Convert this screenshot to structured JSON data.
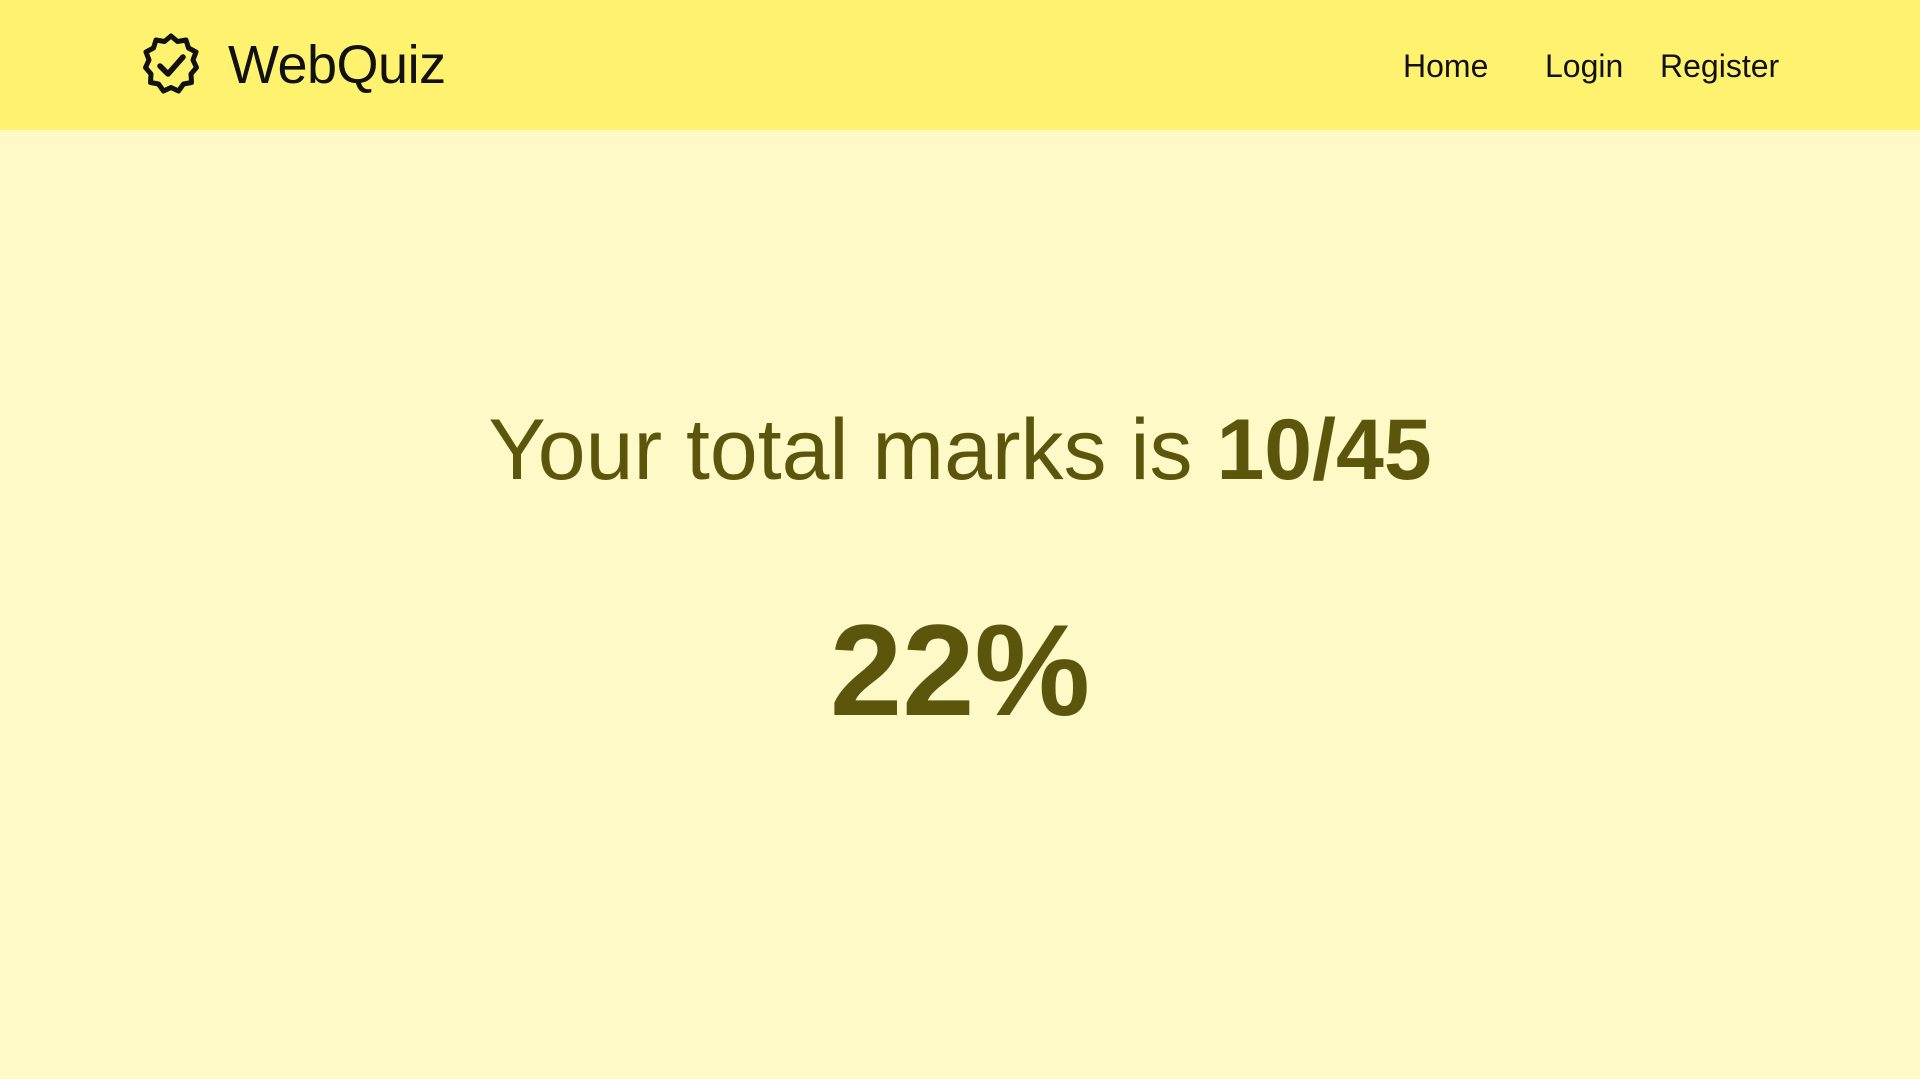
{
  "navbar": {
    "brand": {
      "icon": "badge-check-icon",
      "name": "WebQuiz"
    },
    "links": {
      "home": "Home",
      "login": "Login",
      "register": "Register"
    },
    "background_color": "#fff26e"
  },
  "result": {
    "marks_prefix": "Your total marks is ",
    "marks_score": "10/45",
    "percentage": "22%",
    "text_color": "#5b560c"
  },
  "page": {
    "background_color": "#fef9c6"
  }
}
